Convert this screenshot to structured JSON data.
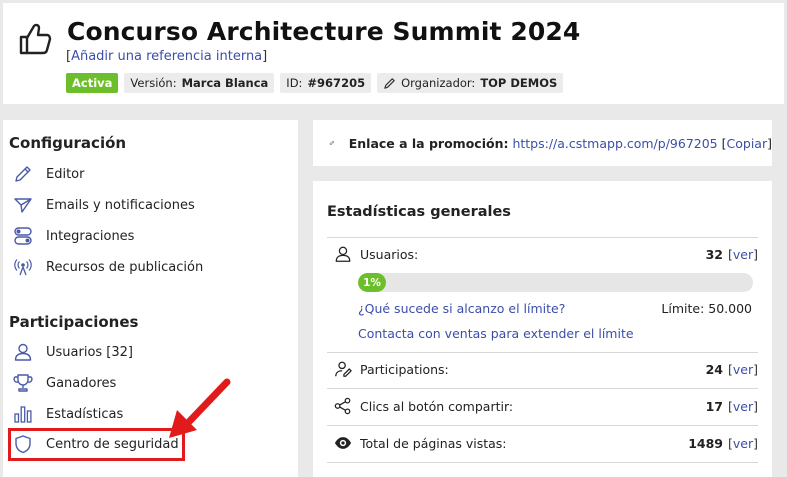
{
  "header": {
    "title": "Concurso Architecture Summit 2024",
    "ref_open": "[",
    "ref_link": "Añadir una referencia interna",
    "ref_close": "]",
    "badges": {
      "status": "Activa",
      "version_label": "Versión:",
      "version_value": "Marca Blanca",
      "id_label": "ID:",
      "id_value": "#967205",
      "organizer_label": "Organizador:",
      "organizer_value": "TOP DEMOS"
    }
  },
  "sidebar": {
    "config_title": "Configuración",
    "config_items": [
      {
        "label": "Editor",
        "icon": "pencil-icon"
      },
      {
        "label": "Emails y notificaciones",
        "icon": "paper-plane-icon"
      },
      {
        "label": "Integraciones",
        "icon": "toggles-icon"
      },
      {
        "label": "Recursos de publicación",
        "icon": "broadcast-icon"
      }
    ],
    "part_title": "Participaciones",
    "part_items": [
      {
        "label": "Usuarios [32]",
        "icon": "user-icon"
      },
      {
        "label": "Ganadores",
        "icon": "trophy-icon"
      },
      {
        "label": "Estadísticas",
        "icon": "bar-chart-icon"
      },
      {
        "label": "Centro de seguridad",
        "icon": "shield-icon"
      }
    ]
  },
  "promo": {
    "label": "Enlace a la promoción:",
    "url": "https://a.cstmapp.com/p/967205",
    "copy_open": "[",
    "copy_label": "Copiar",
    "copy_close": "]"
  },
  "stats": {
    "title": "Estadísticas generales",
    "users": {
      "label": "Usuarios:",
      "value": "32",
      "ver": "ver",
      "progress_label": "1%",
      "progress_percent": 1,
      "limit_question": "¿Qué sucede si alcanzo el límite?",
      "limit_value": "Límite: 50.000",
      "contact": "Contacta con ventas para extender el límite"
    },
    "participations": {
      "label": "Participations:",
      "value": "24",
      "ver": "ver"
    },
    "share_clicks": {
      "label": "Clics al botón compartir:",
      "value": "17",
      "ver": "ver"
    },
    "page_views": {
      "label": "Total de páginas vistas:",
      "value": "1489",
      "ver": "ver"
    }
  },
  "colors": {
    "accent_green": "#6cbf2a",
    "link_blue": "#3b4fa8",
    "highlight_red": "#e11b1b",
    "icon_blue": "#4a5aa8"
  }
}
